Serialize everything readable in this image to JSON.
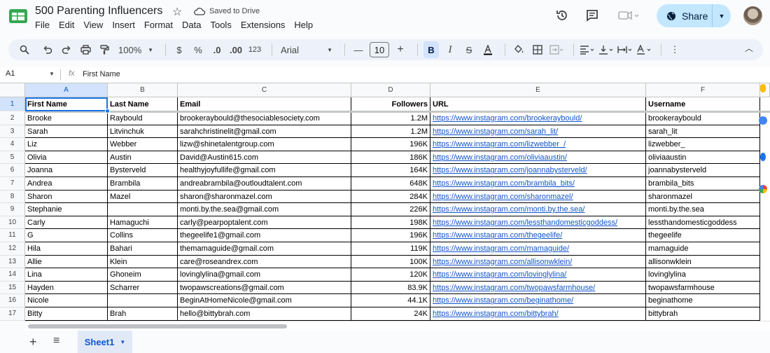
{
  "header": {
    "title": "500 Parenting Influencers",
    "saved_status": "Saved to Drive",
    "share_label": "Share",
    "menu": [
      "File",
      "Edit",
      "View",
      "Insert",
      "Format",
      "Data",
      "Tools",
      "Extensions",
      "Help"
    ],
    "accent_color": "#c2e7ff"
  },
  "toolbar": {
    "zoom": "100%",
    "currency": "$",
    "percent": "%",
    "decrease_decimal": ".0",
    "increase_decimal": ".00",
    "number_format": "123",
    "font": "Arial",
    "font_size": "10"
  },
  "formula_bar": {
    "cell_ref": "A1",
    "fx": "fx",
    "value": "First Name"
  },
  "grid": {
    "columns": [
      "A",
      "B",
      "C",
      "D",
      "E",
      "F"
    ],
    "header_row": {
      "row_number": "1",
      "cells": [
        "First Name",
        "Last Name",
        "Email",
        "Followers",
        "URL",
        "Username"
      ]
    },
    "rows": [
      {
        "n": "2",
        "cells": [
          "Brooke",
          "Raybould",
          "brookeraybould@thesociablesociety.com",
          "1.2M",
          "https://www.instagram.com/brookeraybould/",
          "brookeraybould"
        ]
      },
      {
        "n": "3",
        "cells": [
          "Sarah",
          "Litvinchuk",
          "sarahchristinelit@gmail.com",
          "1.2M",
          "https://www.instagram.com/sarah_lit/",
          "sarah_lit"
        ]
      },
      {
        "n": "4",
        "cells": [
          "Liz",
          "Webber",
          "lizw@shinetalentgroup.com",
          "196K",
          "https://www.instagram.com/lizwebber_/",
          "lizwebber_"
        ]
      },
      {
        "n": "5",
        "cells": [
          "Olivia",
          "Austin",
          "David@Austin615.com",
          "186K",
          "https://www.instagram.com/oliviaaustin/",
          "oliviaaustin"
        ]
      },
      {
        "n": "6",
        "cells": [
          "Joanna",
          "Bysterveld",
          "healthyjoyfullife@gmail.com",
          "164K",
          "https://www.instagram.com/joannabysterveld/",
          "joannabysterveld"
        ]
      },
      {
        "n": "7",
        "cells": [
          "Andrea",
          "Brambila",
          "andreabrambila@outloudtalent.com",
          "648K",
          "https://www.instagram.com/brambila_bits/",
          "brambila_bits"
        ]
      },
      {
        "n": "8",
        "cells": [
          "Sharon",
          "Mazel",
          "sharon@sharonmazel.com",
          "284K",
          "https://www.instagram.com/sharonmazel/",
          "sharonmazel"
        ]
      },
      {
        "n": "9",
        "cells": [
          "Stephanie",
          "",
          "monti.by.the.sea@gmail.com",
          "226K",
          "https://www.instagram.com/monti.by.the.sea/",
          "monti.by.the.sea"
        ]
      },
      {
        "n": "10",
        "cells": [
          "Carly",
          "Hamaguchi",
          "carly@pearpoptalent.com",
          "198K",
          "https://www.instagram.com/lessthandomesticgoddess/",
          "lessthandomesticgoddess"
        ]
      },
      {
        "n": "11",
        "cells": [
          "G",
          "Collins",
          "thegeelife1@gmail.com",
          "196K",
          "https://www.instagram.com/thegeelife/",
          "thegeelife"
        ]
      },
      {
        "n": "12",
        "cells": [
          "Hila",
          "Bahari",
          "themamaguide@gmail.com",
          "119K",
          "https://www.instagram.com/mamaguide/",
          "mamaguide"
        ]
      },
      {
        "n": "13",
        "cells": [
          "Allie",
          "Klein",
          "care@roseandrex.com",
          "100K",
          "https://www.instagram.com/allisonwklein/",
          "allisonwklein"
        ]
      },
      {
        "n": "14",
        "cells": [
          "Lina",
          "Ghoneim",
          "lovinglylina@gmail.com",
          "120K",
          "https://www.instagram.com/lovinglylina/",
          "lovinglylina"
        ]
      },
      {
        "n": "15",
        "cells": [
          "Hayden",
          "Scharrer",
          "twopawscreations@gmail.com",
          "83.9K",
          "https://www.instagram.com/twopawsfarmhouse/",
          "twopawsfarmhouse"
        ]
      },
      {
        "n": "16",
        "cells": [
          "Nicole",
          "",
          "BeginAtHomeNicole@gmail.com",
          "44.1K",
          "https://www.instagram.com/beginathome/",
          "beginathome"
        ]
      },
      {
        "n": "17",
        "cells": [
          "Bitty",
          "Brah",
          "hello@bittybrah.com",
          "24K",
          "https://www.instagram.com/bittybrah/",
          "bittybrah"
        ]
      }
    ]
  },
  "bottom": {
    "sheet_name": "Sheet1"
  }
}
